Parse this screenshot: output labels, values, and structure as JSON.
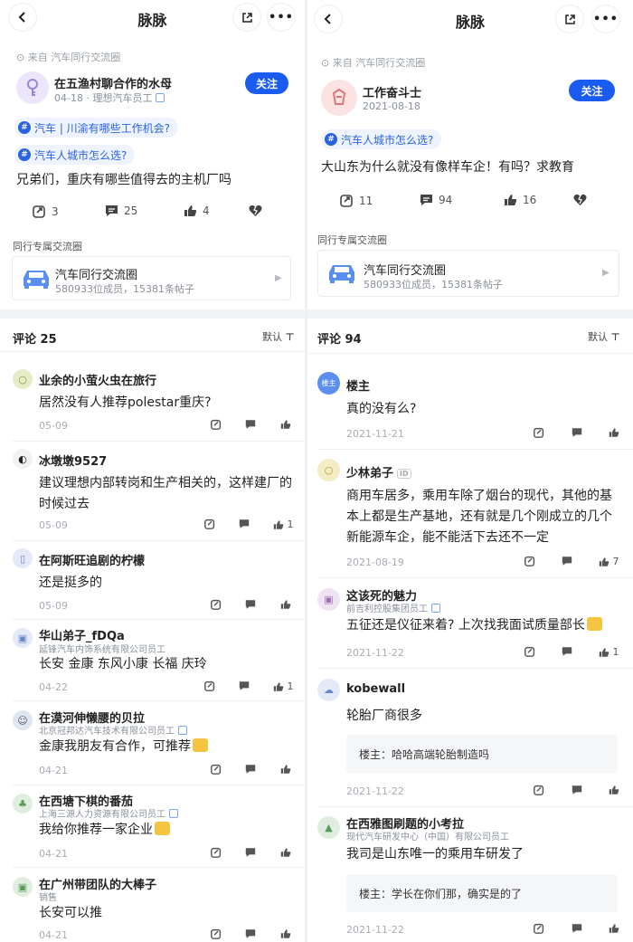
{
  "left": {
    "title": "脉脉",
    "source": "来自 汽车同行交流圈",
    "author": "在五渔村聊合作的水母",
    "author_meta": "04-18 · 理想汽车员工",
    "follow": "关注",
    "tags": [
      "汽车 | 川渝有哪些工作机会?",
      "汽车人城市怎么选?"
    ],
    "post": "兄弟们，重庆有哪些值得去的主机厂吗",
    "actions": {
      "forward": "3",
      "comment": "25",
      "like": "4"
    },
    "circle_label": "同行专属交流圈",
    "circle_name": "汽车同行交流圈",
    "circle_stats": "580933位成员，15381条帖子",
    "comments_header": "评论 25",
    "sort": "默认",
    "comments": [
      {
        "name": "业余的小萤火虫在旅行",
        "company": "",
        "text": "居然没有人推荐polestar重庆?",
        "date": "05-09",
        "likes": ""
      },
      {
        "name": "冰墩墩9527",
        "company": "",
        "text": "建议理想内部转岗和生产相关的，这样建厂的时候过去",
        "date": "05-09",
        "likes": "1"
      },
      {
        "name": "在阿斯旺追剧的柠檬",
        "company": "",
        "text": "还是挺多的",
        "date": "05-09",
        "likes": ""
      },
      {
        "name": "华山弟子_fDQa",
        "company": "延锋汽车内饰系统有限公司员工",
        "text": "长安 金康 东风小康 长福 庆玲",
        "date": "04-22",
        "likes": "1"
      },
      {
        "name": "在漠河伸懒腰的贝拉",
        "company": "北京冠邦达汽车技术有限公司员工",
        "text": "金康我朋友有合作，可推荐",
        "date": "04-21",
        "likes": ""
      },
      {
        "name": "在西塘下棋的番茄",
        "company": "上海三源人力资源有限公司员工",
        "text": "我给你推荐一家企业",
        "date": "04-21",
        "likes": ""
      },
      {
        "name": "在广州带团队的大棒子",
        "company": "销售",
        "text": "长安可以推",
        "date": "04-21",
        "likes": ""
      }
    ]
  },
  "right": {
    "title": "脉脉",
    "source": "来自 汽车同行交流圈",
    "author": "工作奋斗士",
    "author_meta": "2021-08-18",
    "follow": "关注",
    "tags": [
      "汽车人城市怎么选?"
    ],
    "post": "大山东为什么就没有像样车企！有吗？求教育",
    "actions": {
      "forward": "11",
      "comment": "94",
      "like": "16"
    },
    "circle_label": "同行专属交流圈",
    "circle_name": "汽车同行交流圈",
    "circle_stats": "580933位成员，15381条帖子",
    "comments_header": "评论 94",
    "sort": "默认",
    "op_badge": "楼主",
    "id_badge": "ID",
    "comments": [
      {
        "name": "楼主",
        "company": "",
        "text": "真的没有么?",
        "date": "2021-11-21",
        "likes": ""
      },
      {
        "name": "少林弟子",
        "company": "",
        "text": "商用车居多，乘用车除了烟台的现代，其他的基本上都是生产基地，还有就是几个刚成立的几个新能源车企，能不能活下去还不一定",
        "date": "2021-08-19",
        "likes": "7"
      },
      {
        "name": "这该死的魅力",
        "company": "前吉利控股集团员工",
        "text": "五征还是仪征来着? 上次找我面试质量部长",
        "date": "2021-11-22",
        "likes": "1"
      },
      {
        "name": "kobewall",
        "company": "",
        "text": "轮胎厂商很多",
        "date": "2021-11-22",
        "likes": "",
        "reply": "楼主：哈哈高端轮胎制造吗"
      },
      {
        "name": "在西雅图刷题的小考拉",
        "company": "现代汽车研发中心（中国）有限公司员工",
        "text": "我司是山东唯一的乘用车研发了",
        "date": "2021-11-22",
        "likes": "",
        "reply": "楼主：学长在你们那，确实是的了"
      }
    ]
  },
  "colors": {
    "accent": "#1a5cf0",
    "tag_bg": "#eef3fe",
    "divider": "#f0f1f3"
  },
  "icons": [
    "back-icon",
    "share-icon",
    "more-icon",
    "forward-icon",
    "comment-icon",
    "like-icon",
    "dislike-icon",
    "car-icon",
    "filter-icon"
  ]
}
